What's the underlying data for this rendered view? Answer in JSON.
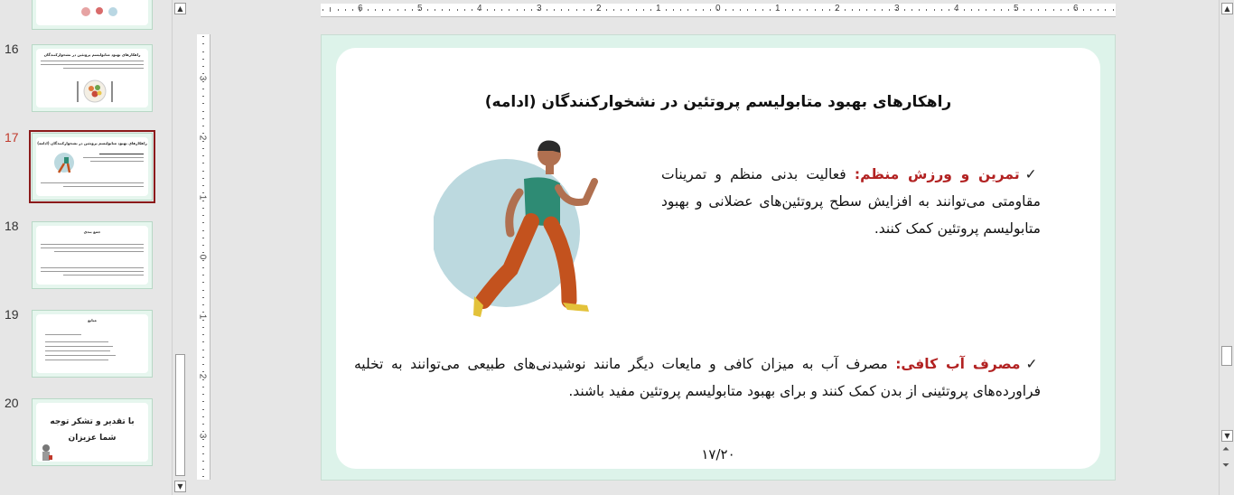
{
  "thumbnails": [
    {
      "number": "16",
      "title": "راهکارهای بهبود متابولیسم پروتئین در نشخوارکنندگان"
    },
    {
      "number": "17",
      "title": "راهکارهای بهبود متابولیسم پروتئین در نشخوارکنندگان (ادامه)"
    },
    {
      "number": "18",
      "title": "جمع بندی"
    },
    {
      "number": "19",
      "title": "منابع"
    },
    {
      "number": "20",
      "title": "با تقدیر و تشکر توجه",
      "subtitle": "شما عزیزان"
    }
  ],
  "ruler": {
    "horizontal_labels": [
      "6",
      "5",
      "4",
      "3",
      "2",
      "1",
      "0",
      "1",
      "2",
      "3",
      "4",
      "5",
      "6"
    ],
    "vertical_labels": [
      "3",
      "2",
      "1",
      "0",
      "1",
      "2",
      "3"
    ]
  },
  "slide": {
    "title": "راهکارهای بهبود متابولیسم پروتئین در نشخوارکنندگان (ادامه)",
    "bullet1_check": "✓",
    "bullet1_head": "تمرین و ورزش منظم:",
    "bullet1_body": " فعالیت بدنی منظم و تمرینات مقاومتی می‌توانند به افزایش سطح پروتئین‌های عضلانی و بهبود متابولیسم پروتئین کمک کنند.",
    "bullet2_check": "✓",
    "bullet2_head": "مصرف آب کافی:",
    "bullet2_body": " مصرف آب به میزان کافی و مایعات دیگر مانند نوشیدنی‌های طبیعی می‌توانند به تخلیه فراورده‌های پروتئینی از بدن کمک کنند و برای بهبود متابولیسم پروتئین مفید باشند.",
    "page_number": "۱۷/۲۰"
  },
  "colors": {
    "accent": "#b22222",
    "slide_bg": "#ddf3ea",
    "selected_thumb": "#8b1a1a"
  }
}
